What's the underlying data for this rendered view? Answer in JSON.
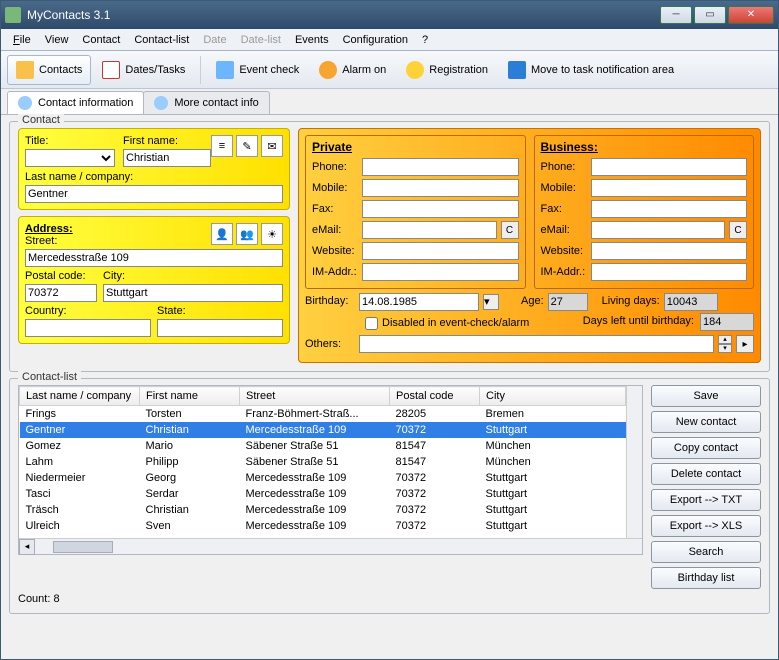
{
  "window": {
    "title": "MyContacts 3.1"
  },
  "menu": {
    "file": "File",
    "view": "View",
    "contact": "Contact",
    "contact_list": "Contact-list",
    "date": "Date",
    "date_list": "Date-list",
    "events": "Events",
    "config": "Configuration",
    "help": "?"
  },
  "toolbar": {
    "contacts": "Contacts",
    "dates": "Dates/Tasks",
    "event_check": "Event check",
    "alarm": "Alarm on",
    "registration": "Registration",
    "move_task": "Move to task notification area"
  },
  "tabs": {
    "info": "Contact information",
    "more": "More contact info"
  },
  "contact_fs": "Contact",
  "contact": {
    "title_lbl": "Title:",
    "title_val": "",
    "first_lbl": "First name:",
    "first_val": "Christian",
    "last_lbl": "Last name / company:",
    "last_val": "Gentner"
  },
  "address": {
    "legend": "Address:",
    "street_lbl": "Street:",
    "street_val": "Mercedesstraße 109",
    "postal_lbl": "Postal code:",
    "postal_val": "70372",
    "city_lbl": "City:",
    "city_val": "Stuttgart",
    "country_lbl": "Country:",
    "country_val": "",
    "state_lbl": "State:",
    "state_val": ""
  },
  "private": {
    "legend": "Private",
    "phone": "Phone:",
    "mobile": "Mobile:",
    "fax": "Fax:",
    "email": "eMail:",
    "website": "Website:",
    "im": "IM-Addr.:"
  },
  "business": {
    "legend": "Business:",
    "phone": "Phone:",
    "mobile": "Mobile:",
    "fax": "Fax:",
    "email": "eMail:",
    "website": "Website:",
    "im": "IM-Addr.:"
  },
  "birthday": {
    "label": "Birthday:",
    "value": "14.08.1985",
    "disabled_lbl": "Disabled in event-check/alarm",
    "age_lbl": "Age:",
    "age_val": "27",
    "living_lbl": "Living days:",
    "living_val": "10043",
    "days_left_lbl": "Days left until birthday:",
    "days_left_val": "184",
    "others_lbl": "Others:",
    "others_val": ""
  },
  "list_fs": "Contact-list",
  "columns": {
    "last": "Last name / company",
    "first": "First name",
    "street": "Street",
    "postal": "Postal code",
    "city": "City"
  },
  "rows": [
    {
      "last": "Frings",
      "first": "Torsten",
      "street": "Franz-Böhmert-Straß...",
      "postal": "28205",
      "city": "Bremen",
      "sel": false
    },
    {
      "last": "Gentner",
      "first": "Christian",
      "street": "Mercedesstraße 109",
      "postal": "70372",
      "city": "Stuttgart",
      "sel": true
    },
    {
      "last": "Gomez",
      "first": "Mario",
      "street": "Säbener Straße 51",
      "postal": "81547",
      "city": "München",
      "sel": false
    },
    {
      "last": "Lahm",
      "first": "Philipp",
      "street": "Säbener Straße 51",
      "postal": "81547",
      "city": "München",
      "sel": false
    },
    {
      "last": "Niedermeier",
      "first": "Georg",
      "street": "Mercedesstraße 109",
      "postal": "70372",
      "city": "Stuttgart",
      "sel": false
    },
    {
      "last": "Tasci",
      "first": "Serdar",
      "street": "Mercedesstraße 109",
      "postal": "70372",
      "city": "Stuttgart",
      "sel": false
    },
    {
      "last": "Träsch",
      "first": "Christian",
      "street": "Mercedesstraße 109",
      "postal": "70372",
      "city": "Stuttgart",
      "sel": false
    },
    {
      "last": "Ulreich",
      "first": "Sven",
      "street": "Mercedesstraße 109",
      "postal": "70372",
      "city": "Stuttgart",
      "sel": false
    }
  ],
  "buttons": {
    "save": "Save",
    "new": "New contact",
    "copy": "Copy contact",
    "delete": "Delete contact",
    "exp_txt": "Export --> TXT",
    "exp_xls": "Export --> XLS",
    "search": "Search",
    "bday": "Birthday list"
  },
  "count": "Count: 8"
}
